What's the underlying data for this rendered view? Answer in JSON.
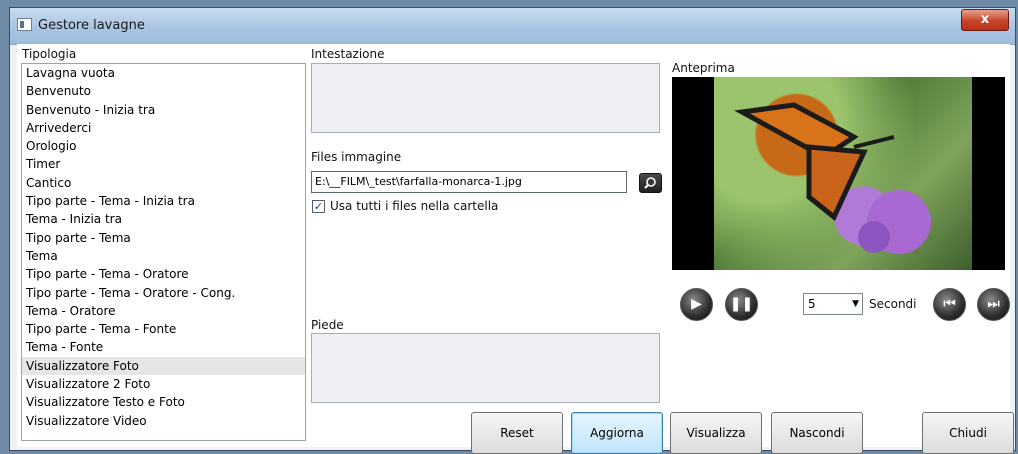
{
  "window": {
    "title": "Gestore lavagne",
    "close_label": "x"
  },
  "left": {
    "label": "Tipologia",
    "items": [
      "Lavagna vuota",
      "Benvenuto",
      "Benvenuto - Inizia tra",
      "Arrivederci",
      "Orologio",
      "Timer",
      "Cantico",
      "Tipo parte - Tema - Inizia tra",
      "Tema - Inizia tra",
      "Tipo parte - Tema",
      "Tema",
      "Tipo parte - Tema - Oratore",
      "Tipo parte - Tema - Oratore - Cong.",
      "Tema - Oratore",
      "Tipo parte - Tema - Fonte",
      "Tema - Fonte",
      "Visualizzatore Foto",
      "Visualizzatore 2 Foto",
      "Visualizzatore Testo e Foto",
      "Visualizzatore Video"
    ],
    "selected": "Visualizzatore Foto"
  },
  "middle": {
    "header_label": "Intestazione",
    "files_label": "Files immagine",
    "file_value": "E:\\__FILM\\_test\\farfalla-monarca-1.jpg",
    "use_all_label": "Usa tutti i files nella cartella",
    "use_all_checked": true,
    "footer_label": "Piede"
  },
  "preview": {
    "label": "Anteprima",
    "seconds_value": "5",
    "seconds_label": "Secondi"
  },
  "buttons": {
    "reset": "Reset",
    "update": "Aggiorna",
    "show": "Visualizza",
    "hide": "Nascondi",
    "close": "Chiudi"
  },
  "icons": {
    "play": "play-icon",
    "pause": "pause-icon",
    "prev": "skip-back-icon",
    "next": "skip-forward-icon",
    "browse": "search-icon"
  }
}
